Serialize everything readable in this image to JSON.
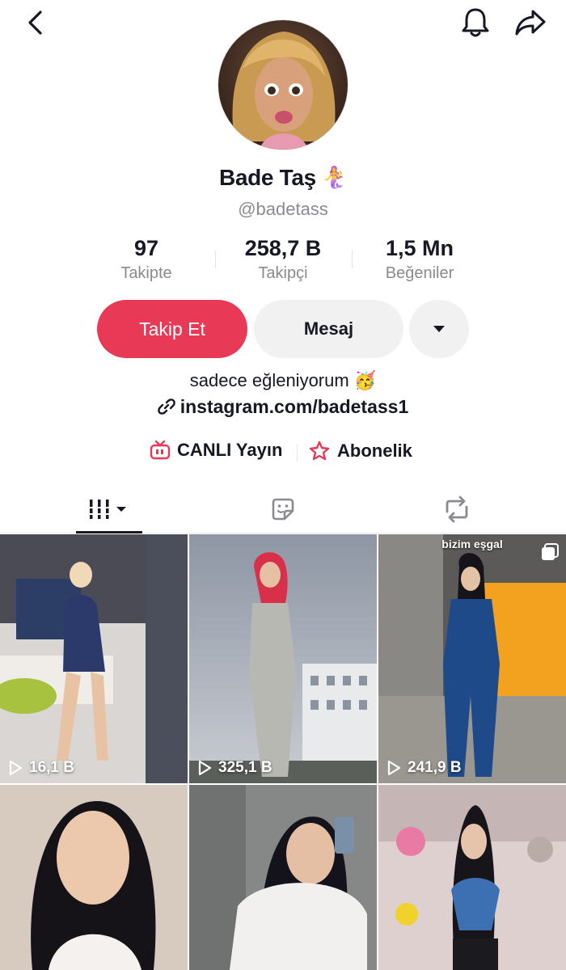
{
  "profile": {
    "name": "Bade Taş",
    "name_emoji": "🧜‍♀️",
    "handle": "@badetass",
    "bio": "sadece eğleniyorum 🥳",
    "link": "instagram.com/badetass1"
  },
  "stats": [
    {
      "value": "97",
      "label": "Takipte"
    },
    {
      "value": "258,7 B",
      "label": "Takipçi"
    },
    {
      "value": "1,5 Mn",
      "label": "Beğeniler"
    }
  ],
  "actions": {
    "follow_label": "Takip Et",
    "message_label": "Mesaj"
  },
  "features": {
    "live_label": "CANLI Yayın",
    "subscription_label": "Abonelik"
  },
  "icons": {
    "back": "chevron-left-icon",
    "notifications": "bell-icon",
    "share": "share-arrow-icon",
    "more": "caret-down-icon",
    "link": "link-icon",
    "live": "live-tv-icon",
    "subscription": "star-icon",
    "tab_videos": "grid-icon",
    "tab_favorites": "sticker-icon",
    "tab_reposts": "repost-icon",
    "play": "play-icon",
    "multi_image": "multi-image-icon"
  },
  "colors": {
    "accent": "#e83a56",
    "secondary_button": "#f1f1f2",
    "muted_text": "#8a8b91",
    "text": "#161823"
  },
  "videos": [
    {
      "views": "16,1 B",
      "overlay": ""
    },
    {
      "views": "325,1 B",
      "overlay": ""
    },
    {
      "views": "241,9 B",
      "overlay": "bizim eşgal"
    },
    {
      "views": "",
      "overlay": ""
    },
    {
      "views": "",
      "overlay": ""
    },
    {
      "views": "",
      "overlay": ""
    }
  ]
}
